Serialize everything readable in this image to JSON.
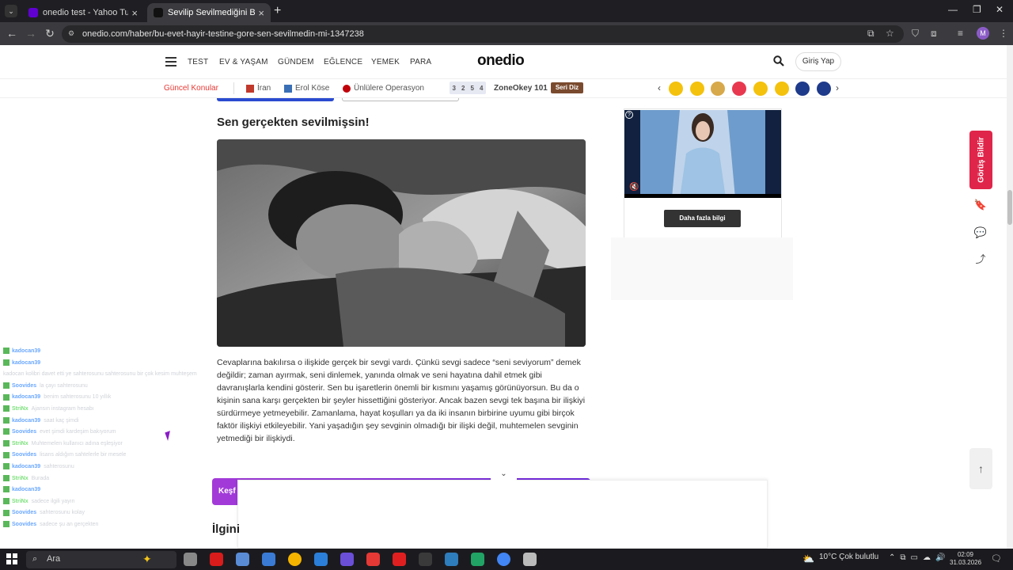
{
  "browser": {
    "tabs": [
      {
        "title": "onedio test - Yahoo Turkey Ara",
        "favicon_color": "#6001d2"
      },
      {
        "title": "Sevilip Sevilmediğini Bu Testte G",
        "favicon_color": "#111111"
      }
    ],
    "url": "onedio.com/haber/bu-evet-hayir-testine-gore-sen-sevilmedin-mi-1347238",
    "profile_initial": "M"
  },
  "header": {
    "menu_items": [
      "TEST",
      "EV & YAŞAM",
      "GÜNDEM",
      "EĞLENCE",
      "YEMEK",
      "PARA"
    ],
    "logo": "onedio",
    "login_label": "Giriş Yap"
  },
  "subbar": {
    "label": "Güncel Konular",
    "topics": [
      "İran",
      "Erol Köse",
      "Ünlülere Operasyon"
    ],
    "zone_digits": [
      "3",
      "2",
      "5",
      "4"
    ],
    "zone_label": "ZoneOkey 101",
    "seri_label": "Seri Diz",
    "emoji_colors": [
      "#f4c20d",
      "#f4c20d",
      "#d8a94a",
      "#e8384f",
      "#f4c20d",
      "#f4c20d",
      "#1e3a8a",
      "#1e3a8a"
    ]
  },
  "article": {
    "heading": "Sen gerçekten sevilmişsin!",
    "paragraph": "Cevaplarına bakılırsa o ilişkide gerçek bir sevgi vardı. Çünkü sevgi sadece “seni seviyorum” demek değildir; zaman ayırmak, seni dinlemek, yanında olmak ve seni hayatına dahil etmek gibi davranışlarla kendini gösterir. Sen bu işaretlerin önemli bir kısmını yaşamış görünüyorsun. Bu da o kişinin sana karşı gerçekten bir şeyler hissettiğini gösteriyor. Ancak bazen sevgi tek başına bir ilişkiyi sürdürmeye yetmeyebilir. Zamanlama, hayat koşulları ya da iki insanın birbirine uyumu gibi birçok faktör ilişkiyi etkileyebilir. Yani yaşadığın şey sevginin olmadığı bir ilişki değil, muhtemelen sevginin yetmediği bir ilişkiydi.",
    "kesfet_label": "Keşf",
    "ilgini_label": "İlgini"
  },
  "ad": {
    "button_label": "Daha fazla bilgi"
  },
  "side": {
    "feedback_label": "Görüş Bildir"
  },
  "chat": [
    {
      "name": "kadocan39",
      "text": "",
      "color": "#6aa8ff"
    },
    {
      "name": "kadocan39",
      "text": "",
      "color": "#6aa8ff"
    },
    {
      "name": "",
      "text": "kadocan kolibri davet etti ye sahterosunu sahterosunu bir çok kesim muhteşem",
      "color": "#cfd2d8"
    },
    {
      "name": "Soovides",
      "text": "la çayı sahterosunu",
      "color": "#6aa8ff"
    },
    {
      "name": "kadocan39",
      "text": "benim sahterosunu 10 yıllık",
      "color": "#6aa8ff"
    },
    {
      "name": "StriNx",
      "text": "Ajansın instagram hesabı",
      "color": "#7be07b"
    },
    {
      "name": "kadocan39",
      "text": "saat kaç şimdi",
      "color": "#6aa8ff"
    },
    {
      "name": "Soovides",
      "text": "evet şimdi kardeşim bakıyorum",
      "color": "#6aa8ff"
    },
    {
      "name": "StriNx",
      "text": "Muhtemelen kullanıcı adına eşleşiyor",
      "color": "#7be07b"
    },
    {
      "name": "Soovides",
      "text": "lisans aldığım sahtelerle bir mesele",
      "color": "#6aa8ff"
    },
    {
      "name": "kadocan39",
      "text": "sahterosunu",
      "color": "#6aa8ff"
    },
    {
      "name": "StriNx",
      "text": "Burada",
      "color": "#7be07b"
    },
    {
      "name": "kadocan39",
      "text": "",
      "color": "#6aa8ff"
    },
    {
      "name": "StriNx",
      "text": "sadece ilgili yayın",
      "color": "#7be07b"
    },
    {
      "name": "Soovides",
      "text": "sahterosunu kolay",
      "color": "#6aa8ff"
    },
    {
      "name": "Soovides",
      "text": "sadece şu an gerçekten",
      "color": "#6aa8ff"
    }
  ],
  "taskbar": {
    "search_placeholder": "Ara",
    "weather": "10°C  Çok bulutlu",
    "time": "02:09",
    "date": "31.03.2026"
  }
}
